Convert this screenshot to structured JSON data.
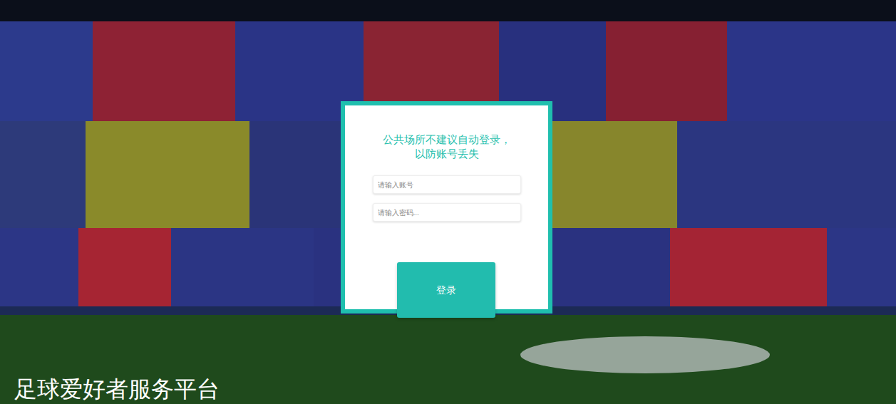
{
  "page": {
    "title": "足球爱好者服务平台"
  },
  "login": {
    "notice_lines": [
      "公共场所不建议自动登录，",
      "以防账号丢失"
    ],
    "fields": [
      {
        "placeholder": "请输入账号",
        "kind": "text"
      },
      {
        "placeholder": "请输入密码...",
        "kind": "password"
      }
    ],
    "button": "登录"
  }
}
